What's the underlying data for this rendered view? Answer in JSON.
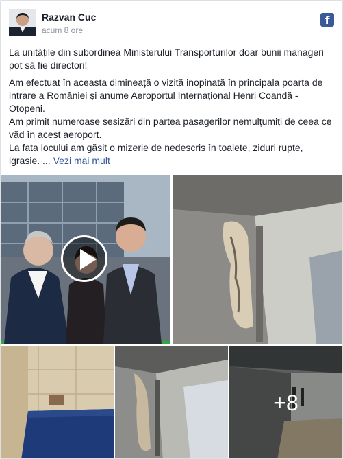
{
  "post": {
    "author": "Razvan Cuc",
    "timestamp": "acum 8 ore",
    "text": [
      "La unitățile din subordinea Ministerului Transporturilor doar bunii manageri pot să fie directori!",
      "Am efectuat în aceasta dimineață o vizită inopinată în principala poarta de intrare a României și anume Aeroportul Internațional Henri Coandă - Otopeni.",
      "Am primit numeroase sesizări din partea pasagerilor nemulțumiți de ceea ce văd în acest aeroport.",
      "La fata locului am găsit o mizerie de nedescris în toalete, ziduri rupte, igrasie. ..."
    ],
    "see_more": "Vezi mai mult",
    "more_photos": "+8"
  },
  "icons": {
    "facebook": "facebook-icon",
    "play": "play-icon"
  },
  "colors": {
    "link": "#365899",
    "facebook": "#3b5998"
  }
}
